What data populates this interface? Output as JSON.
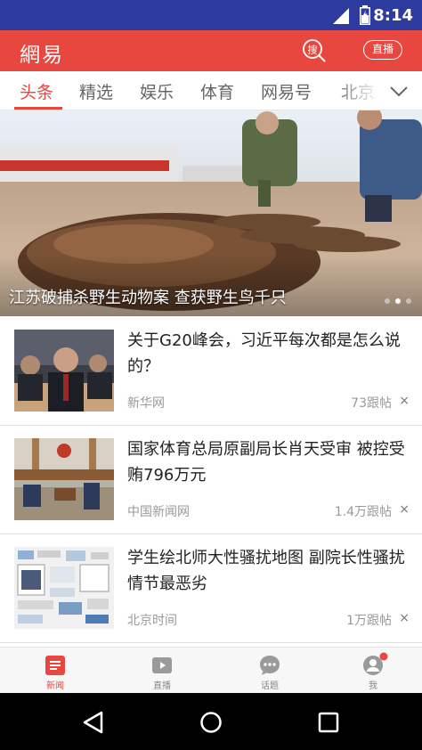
{
  "status_bar": {
    "time": "8:14"
  },
  "app_bar": {
    "logo": "網易",
    "live_label": "直播"
  },
  "tabs": [
    "头条",
    "精选",
    "娱乐",
    "体育",
    "网易号",
    "北京"
  ],
  "active_tab": 0,
  "hero": {
    "caption": "江苏破捕杀野生动物案 查获野生鸟千只",
    "slide_count": 3,
    "active_slide": 1
  },
  "news": [
    {
      "title": "关于G20峰会，习近平每次都是怎么说的？",
      "source": "新华网",
      "replies": "73跟帖",
      "dismiss": "×"
    },
    {
      "title": "国家体育总局原副局长肖天受审 被控受贿796万元",
      "source": "中国新闻网",
      "replies": "1.4万跟帖",
      "dismiss": "×"
    },
    {
      "title": "学生绘北师大性骚扰地图 副院长性骚扰情节最恶劣",
      "source": "北京时间",
      "replies": "1万跟帖",
      "dismiss": "×"
    }
  ],
  "bottom_nav": [
    {
      "label": "新闻",
      "icon": "news-icon",
      "active": true
    },
    {
      "label": "直播",
      "icon": "play-icon",
      "active": false
    },
    {
      "label": "话题",
      "icon": "chat-icon",
      "active": false
    },
    {
      "label": "我",
      "icon": "profile-icon",
      "active": false,
      "badge": true
    }
  ],
  "colors": {
    "brand": "#e8473f",
    "status_bar": "#2d3a9e"
  }
}
